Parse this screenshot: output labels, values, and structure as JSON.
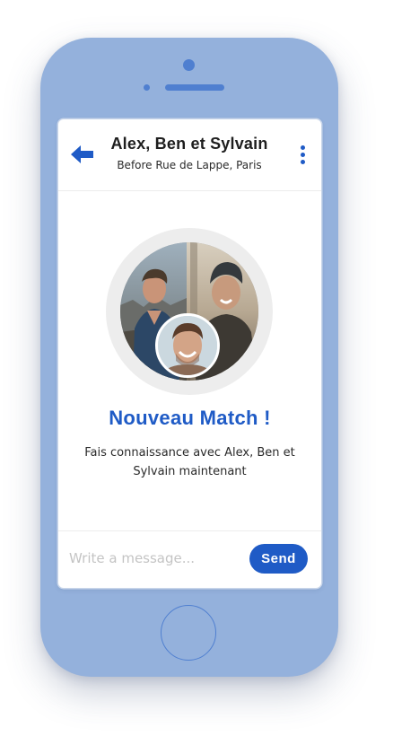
{
  "header": {
    "title": "Alex, Ben et Sylvain",
    "subtitle": "Before Rue de Lappe, Paris",
    "back_icon": "back-arrow-icon",
    "menu_icon": "more-vertical-icon"
  },
  "match": {
    "title": "Nouveau Match !",
    "description": "Fais connaissance avec Alex, Ben et Sylvain maintenant",
    "avatars": [
      "avatar-alex",
      "avatar-ben",
      "avatar-sylvain"
    ]
  },
  "composer": {
    "placeholder": "Write a message...",
    "send_label": "Send"
  },
  "colors": {
    "accent": "#1f5bc6",
    "phone_body": "#94b1dc",
    "phone_detail": "#4f7fd0"
  }
}
